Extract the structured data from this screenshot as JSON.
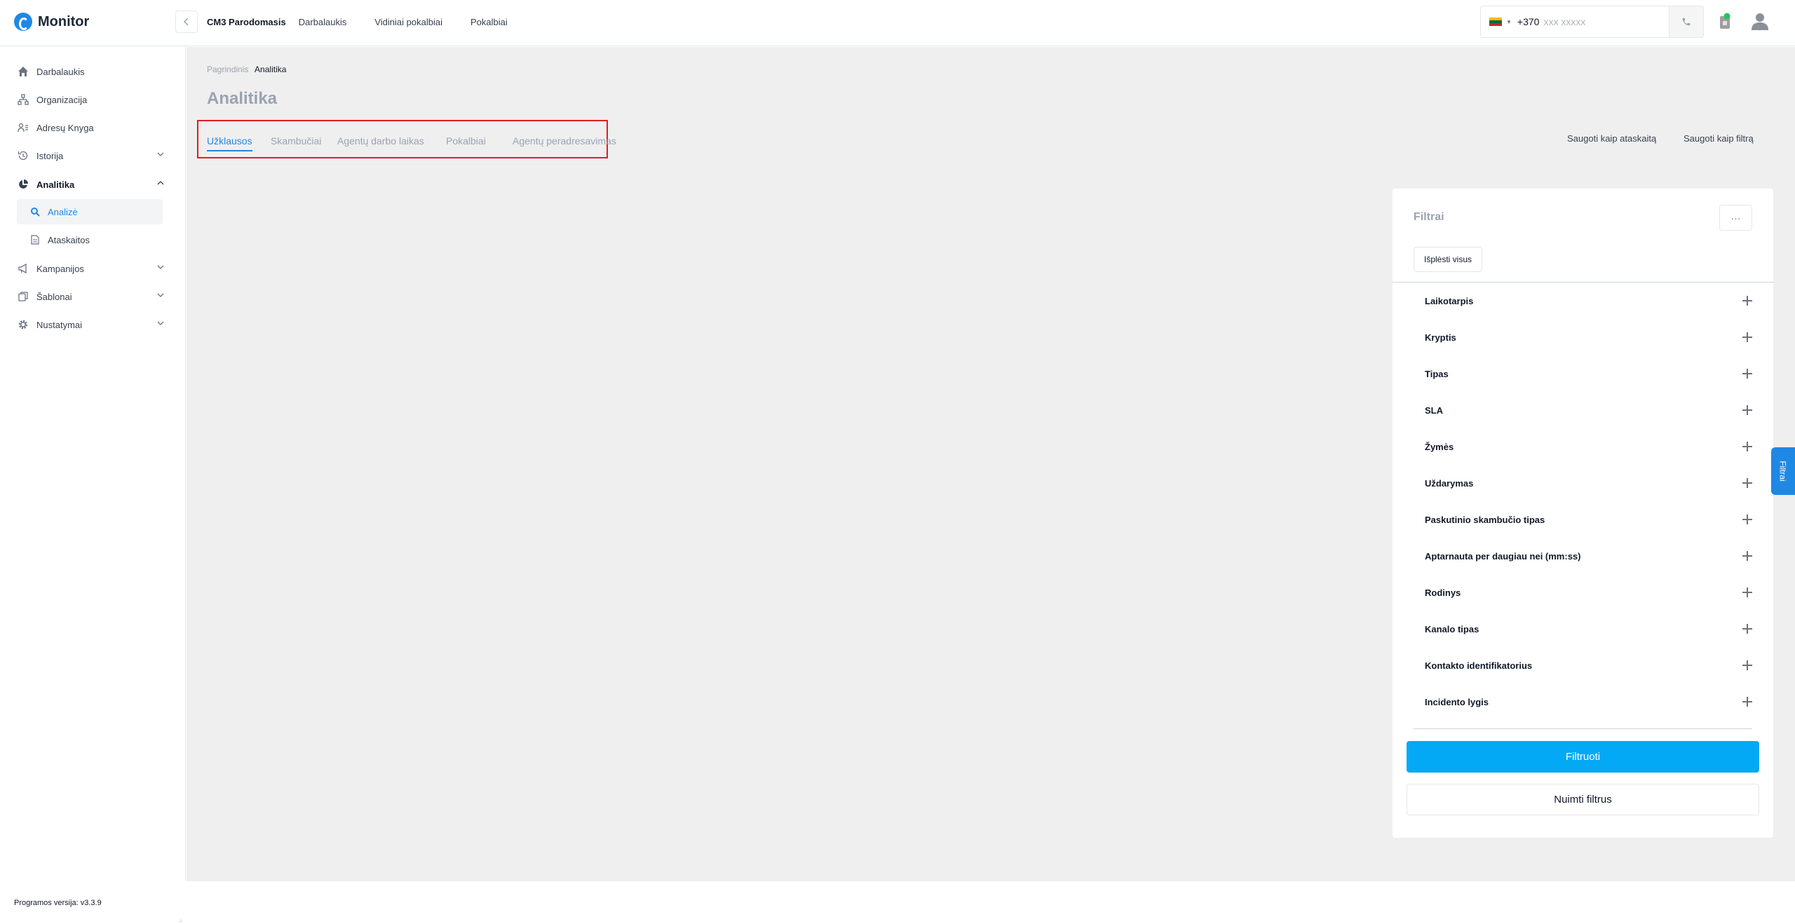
{
  "app": {
    "logo_text": "Monitor"
  },
  "header": {
    "company": "CM3 Parodomasis",
    "nav": [
      "Darbalaukis",
      "Vidiniai pokalbiai",
      "Pokalbiai"
    ],
    "phone": {
      "country_code": "+370",
      "placeholder": "xxx xxxxx"
    }
  },
  "sidebar": {
    "items": [
      {
        "label": "Darbalaukis",
        "icon": "home-icon"
      },
      {
        "label": "Organizacija",
        "icon": "org-chart-icon"
      },
      {
        "label": "Adresų Knyga",
        "icon": "address-book-icon"
      },
      {
        "label": "Istorija",
        "icon": "history-icon"
      },
      {
        "label": "Analitika",
        "icon": "pie-chart-icon"
      },
      {
        "label": "Kampanijos",
        "icon": "megaphone-icon"
      },
      {
        "label": "Šablonai",
        "icon": "template-icon"
      },
      {
        "label": "Nustatymai",
        "icon": "gear-icon"
      }
    ],
    "sub_items": [
      {
        "label": "Analizė",
        "icon": "search-icon"
      },
      {
        "label": "Ataskaitos",
        "icon": "document-icon"
      }
    ]
  },
  "main": {
    "breadcrumb": [
      "Pagrindinis",
      "Analitika"
    ],
    "title": "Analitika",
    "tabs": [
      "Užklausos",
      "Skambučiai",
      "Agentų darbo laikas",
      "Pokalbiai",
      "Agentų peradresavimas"
    ],
    "actions": {
      "save_report": "Saugoti kaip ataskaitą",
      "save_filter": "Saugoti kaip filtrą"
    }
  },
  "filters": {
    "title": "Filtrai",
    "more": "···",
    "expand_all": "Išplėsti visus",
    "rows": [
      "Laikotarpis",
      "Kryptis",
      "Tipas",
      "SLA",
      "Žymės",
      "Uždarymas",
      "Paskutinio skambučio tipas",
      "Aptarnauta per daugiau nei (mm:ss)",
      "Rodinys",
      "Kanalo tipas",
      "Kontakto identifikatorius",
      "Incidento lygis"
    ],
    "apply": "Filtruoti",
    "clear": "Nuimti filtrus",
    "side_tab": "Filtrai"
  },
  "footer": {
    "version": "Programos versija: v3.3.9"
  },
  "colors": {
    "accent": "#1e88e5",
    "primary_button": "#03a9f4",
    "highlight_border": "#e11d21"
  }
}
